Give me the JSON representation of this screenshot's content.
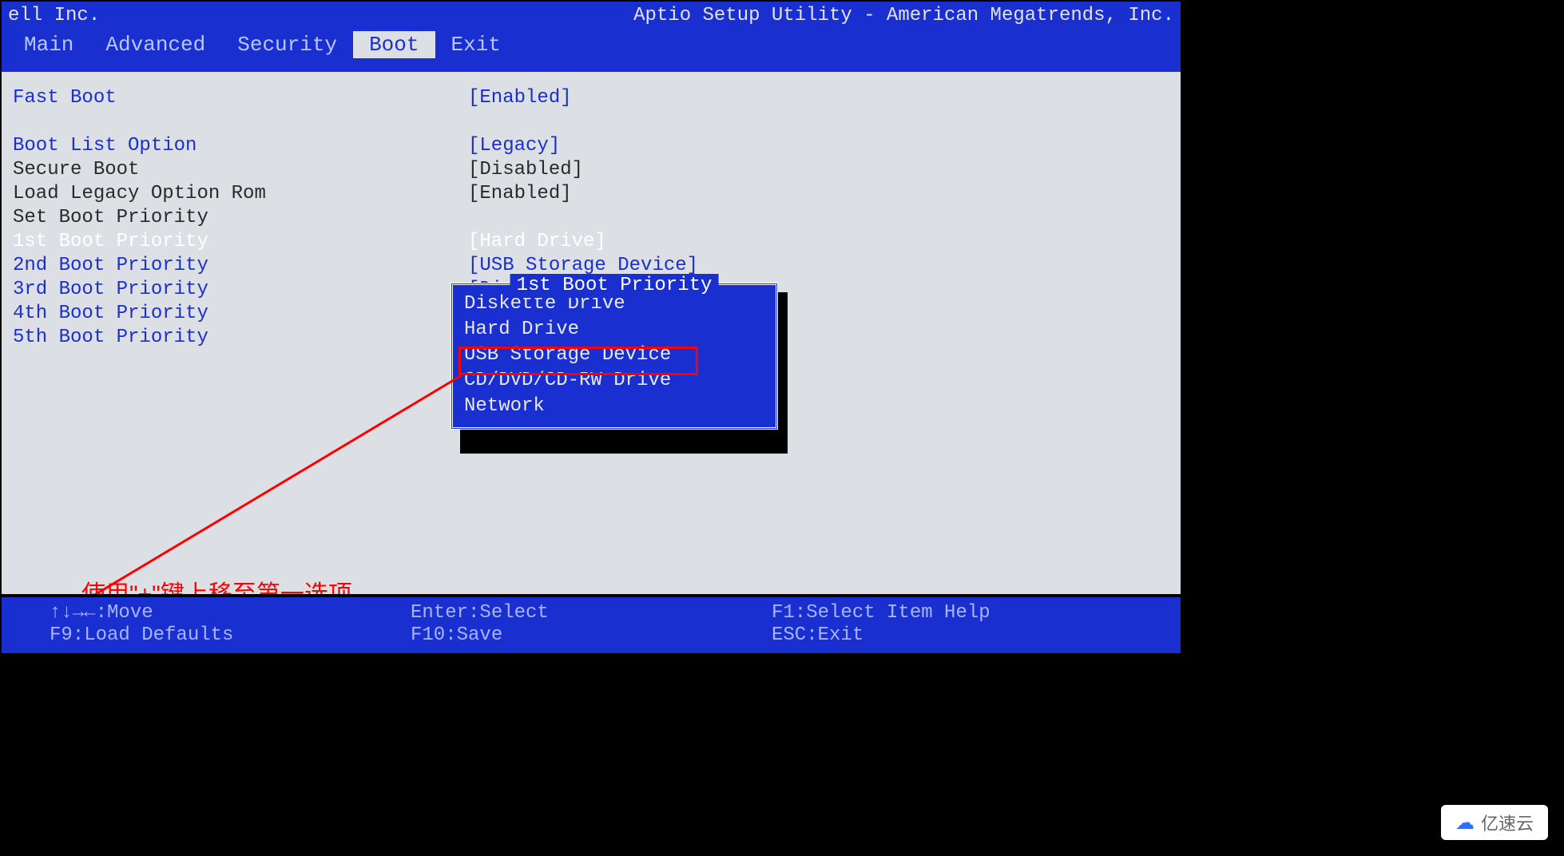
{
  "header": {
    "vendor": "ell Inc.",
    "utility": "Aptio Setup Utility - American Megatrends, Inc."
  },
  "nav": {
    "items": [
      "Main",
      "Advanced",
      "Security",
      "Boot",
      "Exit"
    ],
    "active_index": 3
  },
  "settings": [
    {
      "label": "Fast Boot",
      "value": "[Enabled]",
      "labelClass": "",
      "valClass": ""
    },
    {
      "label": "",
      "value": ""
    },
    {
      "label": "Boot List Option",
      "value": "[Legacy]",
      "labelClass": "",
      "valClass": ""
    },
    {
      "label": "Secure Boot",
      "value": "[Disabled]",
      "labelClass": "black",
      "valClass": "black"
    },
    {
      "label": "Load Legacy Option Rom",
      "value": "[Enabled]",
      "labelClass": "black",
      "valClass": "black"
    },
    {
      "label": "Set Boot Priority",
      "value": "",
      "labelClass": "black"
    },
    {
      "label": "1st Boot Priority",
      "value": "[Hard Drive]",
      "labelClass": "white",
      "valClass": "white"
    },
    {
      "label": "2nd Boot Priority",
      "value": "[USB Storage Device]",
      "labelClass": "",
      "valClass": ""
    },
    {
      "label": "3rd Boot Priority",
      "value": "[Diskette Drive]",
      "labelClass": "",
      "valClass": ""
    },
    {
      "label": "4th Boot Priority",
      "value": "",
      "labelClass": "",
      "valClass": ""
    },
    {
      "label": "5th Boot Priority",
      "value": "",
      "labelClass": "",
      "valClass": ""
    }
  ],
  "popup": {
    "title": "1st Boot Priority",
    "items": [
      "Diskette Drive",
      "Hard Drive",
      "USB Storage Device",
      "CD/DVD/CD-RW Drive",
      "Network"
    ],
    "highlighted_index": 2
  },
  "annotation": "使用\"+\"键上移至第一选项",
  "footer": {
    "rows": [
      [
        "↑↓→←:Move",
        "Enter:Select",
        "F1:Select Item Help"
      ],
      [
        "F9:Load Defaults",
        "F10:Save",
        "ESC:Exit"
      ]
    ]
  },
  "watermark": "亿速云"
}
